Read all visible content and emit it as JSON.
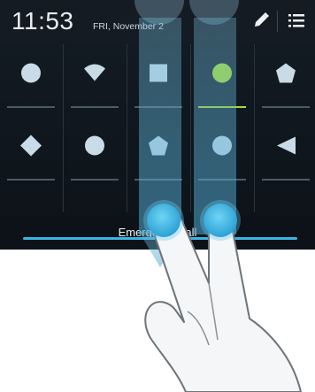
{
  "status_bar": {
    "time": "11:53",
    "date": "FRI, November 2",
    "edit_icon": "pencil-icon",
    "menu_icon": "list-icon"
  },
  "quick_settings": {
    "rows": [
      [
        {
          "shape": "circle",
          "active": false
        },
        {
          "shape": "wifi-wedge",
          "active": false
        },
        {
          "shape": "square",
          "active": false
        },
        {
          "shape": "circle",
          "active": true
        },
        {
          "shape": "pentagon",
          "active": false
        }
      ],
      [
        {
          "shape": "diamond",
          "active": false
        },
        {
          "shape": "circle",
          "active": false
        },
        {
          "shape": "pentagon",
          "active": false
        },
        {
          "shape": "circle",
          "active": false
        },
        {
          "shape": "triangle-left",
          "active": false
        }
      ]
    ]
  },
  "emergency": {
    "label": "Emergency call"
  },
  "gesture": {
    "description_icon": "two-finger-swipe-hand-icon"
  },
  "colors": {
    "accent": "#39b6e6",
    "active": "#a7dd2a",
    "icon": "#c9dbe6",
    "shade": "#141c24"
  }
}
